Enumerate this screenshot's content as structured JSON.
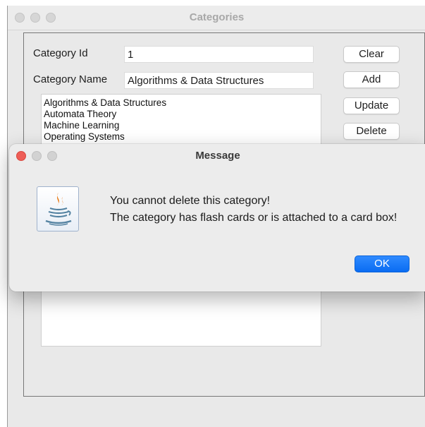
{
  "window": {
    "title": "Categories"
  },
  "form": {
    "category_id_label": "Category Id",
    "category_id_value": "1",
    "category_name_label": "Category Name",
    "category_name_value": "Algorithms & Data Structures"
  },
  "buttons": {
    "clear": "Clear",
    "add": "Add",
    "update": "Update",
    "delete": "Delete"
  },
  "category_list": [
    "Algorithms & Data Structures",
    "Automata Theory",
    "Machine Learning",
    "Operating Systems"
  ],
  "dialog": {
    "title": "Message",
    "icon": "java-icon",
    "line1": "You cannot delete this category!",
    "line2": "The category has flash cards or is attached to a card box!",
    "ok": "OK",
    "accent_color": "#0a6cf2",
    "close_color": "#ee5e57"
  }
}
